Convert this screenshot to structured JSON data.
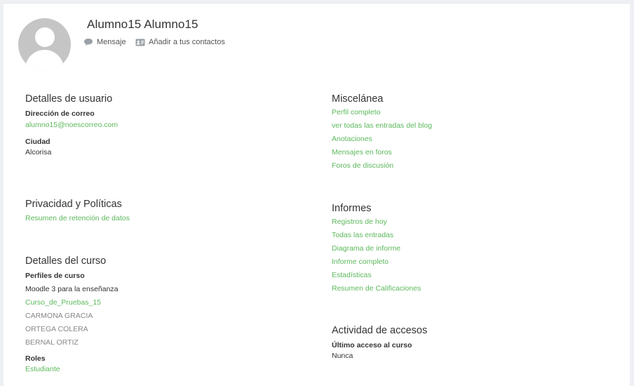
{
  "header": {
    "name": "Alumno15 Alumno15",
    "message_label": "Mensaje",
    "add_contact_label": "Añadir a tus contactos"
  },
  "user_details": {
    "title": "Detalles de usuario",
    "email_label": "Dirección de correo",
    "email_value": "alumno15@noescorreo.com",
    "city_label": "Ciudad",
    "city_value": "Alcorisa"
  },
  "privacy": {
    "title": "Privacidad y Políticas",
    "link": "Resumen de retención de datos"
  },
  "course_details": {
    "title": "Detalles del curso",
    "profiles_label": "Perfiles de curso",
    "items": [
      {
        "text": "Moodle 3 para la enseñanza",
        "kind": "plain"
      },
      {
        "text": "Curso_de_Pruebas_15",
        "kind": "link"
      },
      {
        "text": "CARMONA GRACIA",
        "kind": "muted"
      },
      {
        "text": "ORTEGA COLERA",
        "kind": "muted"
      },
      {
        "text": "BERNAL ORTIZ",
        "kind": "muted"
      }
    ],
    "roles_label": "Roles",
    "roles_value": "Estudiante"
  },
  "misc": {
    "title": "Miscelánea",
    "links": [
      "Perfil completo",
      "ver todas las entradas del blog",
      "Anotaciones",
      "Mensajes en foros",
      "Foros de discusión"
    ]
  },
  "reports": {
    "title": "Informes",
    "links": [
      "Registros de hoy",
      "Todas las entradas",
      "Diagrama de informe",
      "Informe completo",
      "Estadísticas",
      "Resumen de Calificaciones"
    ]
  },
  "access": {
    "title": "Actividad de accesos",
    "last_label": "Último acceso al curso",
    "last_value": "Nunca"
  },
  "colors": {
    "link": "#5cb85c",
    "muted": "#888888",
    "background": "#eef0f4"
  }
}
